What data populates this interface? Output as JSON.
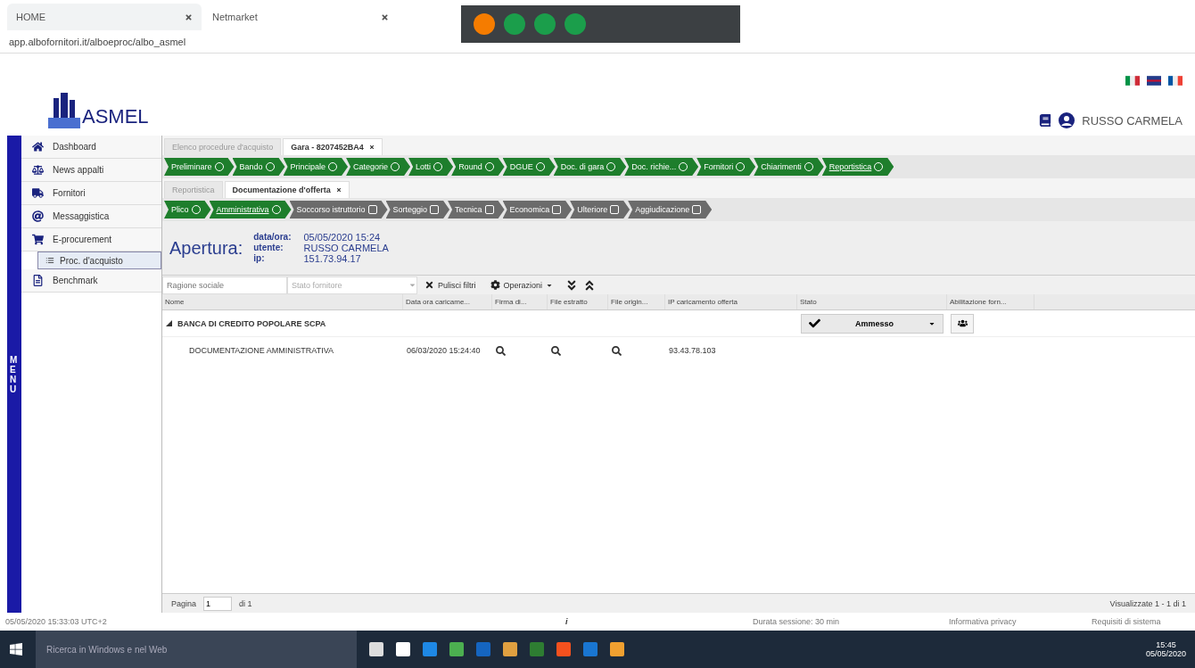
{
  "browser": {
    "tabs": [
      {
        "label": "HOME",
        "selected": false
      },
      {
        "label": "Netmarket",
        "selected": true
      }
    ],
    "url": "app.albofornitori.it/alboeproc/albo_asmel"
  },
  "header": {
    "logo": "ASMEL",
    "user": "RUSSO CARMELA"
  },
  "menu_label": "MENU",
  "sidebar": {
    "items": [
      {
        "label": "Dashboard"
      },
      {
        "label": "News appalti"
      },
      {
        "label": "Fornitori"
      },
      {
        "label": "Messaggistica"
      },
      {
        "label": "E-procurement",
        "children": [
          {
            "label": "Proc. d'acquisto",
            "selected": true
          }
        ]
      },
      {
        "label": "Benchmark"
      }
    ]
  },
  "tabs": [
    {
      "label": "Elenco procedure d'acquisto",
      "selected": false,
      "closable": false
    },
    {
      "label": "Gara - 8207452BA4",
      "selected": true,
      "closable": true
    }
  ],
  "steps": [
    {
      "label": "Preliminare",
      "kind": "done",
      "selected": false
    },
    {
      "label": "Bando",
      "kind": "done",
      "selected": false
    },
    {
      "label": "Principale",
      "kind": "done",
      "selected": false
    },
    {
      "label": "Categorie",
      "kind": "done",
      "selected": false
    },
    {
      "label": "Lotti",
      "kind": "done",
      "selected": false
    },
    {
      "label": "Round",
      "kind": "done",
      "selected": false
    },
    {
      "label": "DGUE",
      "kind": "done",
      "selected": false
    },
    {
      "label": "Doc. di gara",
      "kind": "done",
      "selected": false
    },
    {
      "label": "Doc. richie...",
      "kind": "done",
      "selected": false
    },
    {
      "label": "Fornitori",
      "kind": "done",
      "selected": false
    },
    {
      "label": "Chiarimenti",
      "kind": "done",
      "selected": false
    },
    {
      "label": "Reportistica",
      "kind": "done",
      "selected": true
    }
  ],
  "subtabs": [
    {
      "label": "Reportistica",
      "selected": false,
      "closable": false
    },
    {
      "label": "Documentazione d'offerta",
      "selected": true,
      "closable": true
    }
  ],
  "substeps": [
    {
      "label": "Plico",
      "kind": "done",
      "selected": false
    },
    {
      "label": "Amministrativa",
      "kind": "done",
      "selected": true
    },
    {
      "label": "Soccorso istruttorio",
      "kind": "todo",
      "selected": false
    },
    {
      "label": "Sorteggio",
      "kind": "todo",
      "selected": false
    },
    {
      "label": "Tecnica",
      "kind": "todo",
      "selected": false
    },
    {
      "label": "Economica",
      "kind": "todo",
      "selected": false
    },
    {
      "label": "Ulteriore",
      "kind": "todo",
      "selected": false
    },
    {
      "label": "Aggiudicazione",
      "kind": "todo",
      "selected": false
    }
  ],
  "apertura": {
    "title": "Apertura:",
    "fields": [
      {
        "label": "data/ora:",
        "value": "05/05/2020 15:24"
      },
      {
        "label": "utente:",
        "value": "RUSSO CARMELA"
      },
      {
        "label": "ip:",
        "value": "151.73.94.17"
      }
    ]
  },
  "filters": {
    "name_placeholder": "Ragione sociale",
    "state_placeholder": "Stato fornitore",
    "clear": "Pulisci filtri",
    "operations": "Operazioni"
  },
  "table": {
    "columns": [
      "Nome",
      "Data ora caricame...",
      "Firma di...",
      "File estratto",
      "File origin...",
      "IP caricamento offerta",
      "Stato",
      "Abilitazione forn..."
    ],
    "groups": [
      {
        "name": "BANCA DI CREDITO POPOLARE SCPA",
        "expanded": true,
        "state": "Ammesso",
        "rows": [
          {
            "name": "DOCUMENTAZIONE AMMINISTRATIVA",
            "date": "06/03/2020 15:24:40",
            "ip": "93.43.78.103"
          }
        ]
      }
    ]
  },
  "pager": {
    "page_label": "Pagina",
    "page": "1",
    "of": "di 1",
    "summary": "Visualizzate 1 - 1 di 1"
  },
  "status_bar": {
    "time": "05/05/2020 15:33:03 UTC+2",
    "info": "i",
    "session": "Durata sessione: 30 min",
    "privacy": "Informativa privacy",
    "requirements": "Requisiti di sistema"
  },
  "taskbar": {
    "search_placeholder": "Ricerca in Windows e nel Web",
    "time": "15:45",
    "date": "05/05/2020"
  }
}
